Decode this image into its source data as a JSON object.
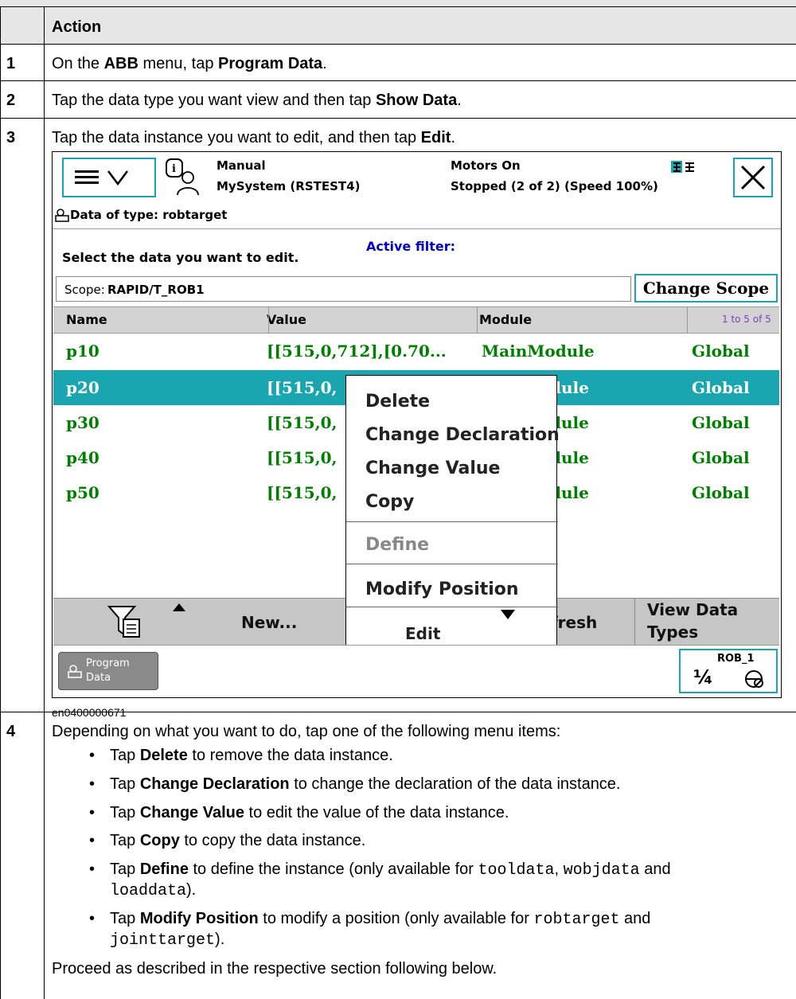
{
  "table": {
    "header": "Action",
    "steps": [
      {
        "num": "1",
        "t1": "On the ",
        "b1": "ABB",
        "t2": " menu, tap ",
        "b2": "Program Data",
        "t3": "."
      },
      {
        "num": "2",
        "t1": "Tap the data type you want view and then tap ",
        "b1": "Show Data",
        "t2": "."
      },
      {
        "num": "3",
        "t1": "Tap the data instance you want to edit, and then tap ",
        "b1": "Edit",
        "t2": "."
      },
      {
        "num": "4",
        "intro": "Depending on what you want to do, tap one of the following menu items:",
        "outro": "Proceed as described in the respective section following below."
      }
    ],
    "caption": "en0400000671",
    "bullets": [
      {
        "pre": "Tap ",
        "bold": "Delete",
        "post": " to remove the data instance."
      },
      {
        "pre": "Tap ",
        "bold": "Change Declaration",
        "post": " to change the declaration of the data instance."
      },
      {
        "pre": "Tap ",
        "bold": "Change Value",
        "post": " to edit the value of the data instance."
      },
      {
        "pre": "Tap ",
        "bold": "Copy",
        "post": " to copy the data instance."
      },
      {
        "pre": "Tap ",
        "bold": "Define",
        "post": " to define the instance (only available for ",
        "code1": "tooldata",
        "mid": ", ",
        "code2": "wobjdata",
        "and": " and",
        "code3": "loaddata",
        "end": ")."
      },
      {
        "pre": "Tap ",
        "bold": "Modify Position",
        "post": " to modify a position (only available for ",
        "code1": "robtarget",
        "and": " and",
        "code2": "jointtarget",
        "end": ")."
      }
    ],
    "bullet_char": "•"
  },
  "flexpendant": {
    "status": {
      "mode": "Manual",
      "system": "MySystem (RSTEST4)",
      "motors": "Motors On",
      "state": "Stopped (2 of 2) (Speed 100%)"
    },
    "data_type_label": "Data of type: robtarget",
    "active_filter": "Active filter:",
    "instruction": "Select the data you want to edit.",
    "scope_label": "Scope:",
    "scope_value": "RAPID/T_ROB1",
    "change_scope": "Change Scope",
    "columns": {
      "name": "Name",
      "value": "Value",
      "module": "Module",
      "range": "1 to 5 of 5"
    },
    "rows": [
      {
        "name": "p10",
        "value": "[[515,0,712],[0.70...",
        "module": "MainModule",
        "scope": "Global"
      },
      {
        "name": "p20",
        "value": "[[515,0,",
        "module": "dule",
        "scope": "Global"
      },
      {
        "name": "p30",
        "value": "[[515,0,",
        "module": "dule",
        "scope": "Global"
      },
      {
        "name": "p40",
        "value": "[[515,0,",
        "module": "dule",
        "scope": "Global"
      },
      {
        "name": "p50",
        "value": "[[515,0,",
        "module": "dule",
        "scope": "Global"
      }
    ],
    "context_menu": [
      "Delete",
      "Change Declaration",
      "Change Value",
      "Copy",
      "Define",
      "Modify Position"
    ],
    "commands": {
      "new": "New...",
      "edit": "Edit",
      "refresh": "Refresh",
      "view1": "View Data",
      "view2": "Types"
    },
    "taskbar": {
      "program_data1": "Program",
      "program_data2": "Data",
      "rob": "ROB_1",
      "speed": "¼"
    },
    "colors": {
      "accent": "#17a2b8",
      "selected_row": "#19a6b0",
      "data_green": "#008000",
      "filter_blue": "#0000cc"
    }
  }
}
